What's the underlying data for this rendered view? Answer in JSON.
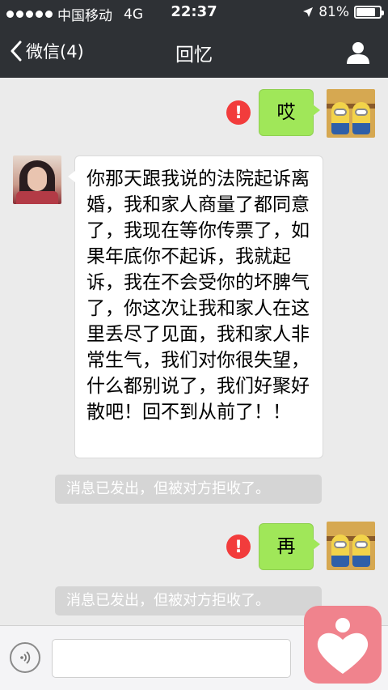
{
  "status_bar": {
    "carrier": "中国移动",
    "network": "4G",
    "time": "22:37",
    "battery": "81%",
    "battery_level": 0.81
  },
  "nav": {
    "back_label": "微信(4)",
    "title": "回忆"
  },
  "messages": [
    {
      "type": "sent",
      "text": "哎",
      "failed": true
    },
    {
      "type": "received",
      "text": "你那天跟我说的法院起诉离婚，我和家人商量了都同意了，我现在等你传票了，如果年底你不起诉，我就起诉，我在不会受你的坏脾气了，你这次让我和家人在这里丢尽了见面，我和家人非常生气，我们对你很失望，什么都别说了，我们好聚好散吧！回不到从前了！！"
    },
    {
      "type": "system",
      "text": "消息已发出，但被对方拒收了。"
    },
    {
      "type": "sent",
      "text": "再",
      "failed": true
    },
    {
      "type": "system",
      "text": "消息已发出，但被对方拒收了。"
    }
  ],
  "error_mark": "!",
  "input": {
    "value": ""
  },
  "colors": {
    "header": "#2e3135",
    "sent_bubble": "#a0e759",
    "error": "#f23c3c",
    "overlay_app": "#f0838d"
  },
  "icons": {
    "back": "chevron-left-icon",
    "profile": "person-icon",
    "voice": "voice-icon",
    "location": "location-arrow-icon",
    "overlay": "heart-icon"
  }
}
